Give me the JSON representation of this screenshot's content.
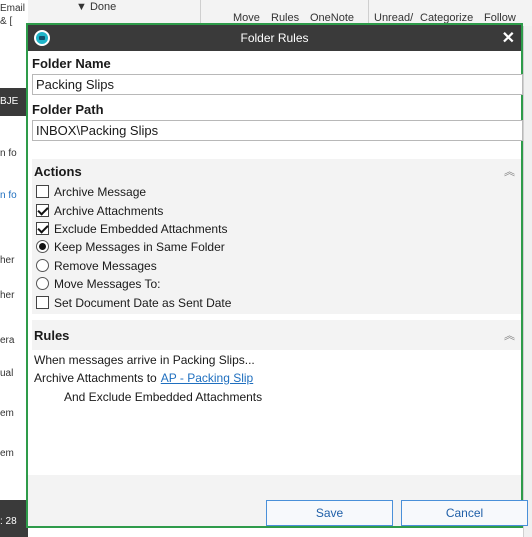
{
  "background": {
    "left_fragments": [
      "Email",
      "& [",
      "BJE",
      "n fo",
      "n fo",
      "her",
      "her",
      "era",
      "ual",
      "em",
      "em",
      ": 28"
    ],
    "toolbar": {
      "done_label": "Done",
      "move_label": "Move",
      "rules_label": "Rules",
      "onenote_label": "OneNote",
      "unread_label": "Unread/",
      "categorize_label": "Categorize",
      "follow_label": "Follow"
    }
  },
  "dialog": {
    "title": "Folder Rules",
    "close_symbol": "✕",
    "folder_name": {
      "label": "Folder Name",
      "value": "Packing Slips"
    },
    "folder_path": {
      "label": "Folder Path",
      "value": "INBOX\\Packing Slips"
    },
    "actions": {
      "header": "Actions",
      "collapse_symbol": "︽",
      "options": [
        {
          "type": "checkbox",
          "label": "Archive Message",
          "checked": false
        },
        {
          "type": "checkbox",
          "label": "Archive Attachments",
          "checked": true
        },
        {
          "type": "checkbox",
          "label": "Exclude Embedded Attachments",
          "checked": true
        },
        {
          "type": "radio",
          "label": "Keep Messages in Same Folder",
          "checked": true
        },
        {
          "type": "radio",
          "label": "Remove Messages",
          "checked": false
        },
        {
          "type": "radio",
          "label": "Move Messages To:",
          "checked": false
        },
        {
          "type": "checkbox",
          "label": "Set Document Date as Sent Date",
          "checked": false
        }
      ]
    },
    "rules": {
      "header": "Rules",
      "collapse_symbol": "︽",
      "line1": "When messages arrive in Packing Slips...",
      "line2_prefix": "Archive Attachments to",
      "line2_link": "AP - Packing Slip",
      "line3": "And Exclude Embedded Attachments"
    },
    "buttons": {
      "save": "Save",
      "cancel": "Cancel"
    },
    "colors": {
      "border": "#2e9b4a",
      "titlebar": "#3a3a3a",
      "link": "#1f6fbf",
      "button_border": "#4a90d9"
    }
  }
}
